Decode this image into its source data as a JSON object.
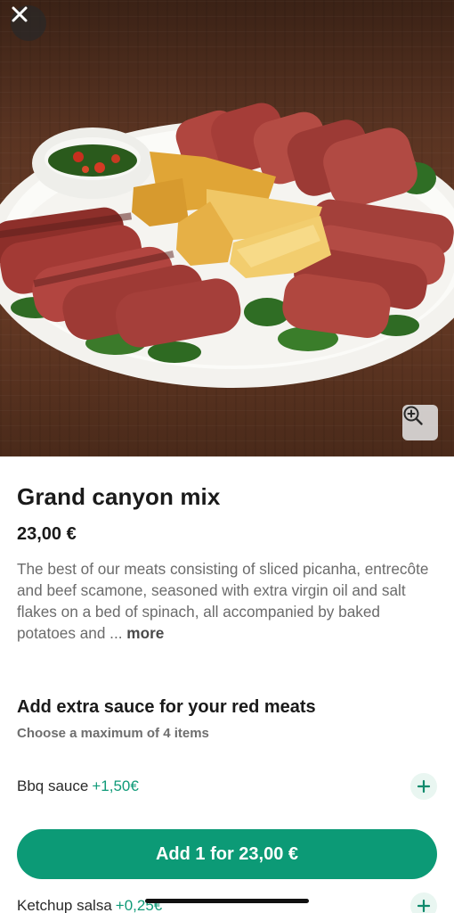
{
  "product": {
    "title": "Grand canyon mix",
    "price": "23,00 €",
    "description": "The best of our meats consisting of sliced picanha, entrecôte and beef scamone, seasoned with extra virgin oil and salt flakes on a bed of spinach, all accompanied by baked potatoes and ...",
    "more_label": "more"
  },
  "extras": {
    "title": "Add extra sauce for your red meats",
    "subtitle": "Choose a maximum of 4 items",
    "options": [
      {
        "label": "Bbq sauce",
        "price": "+1,50€"
      },
      {
        "label": "Ketchup salsa",
        "price": "+0,25€"
      }
    ]
  },
  "cta": {
    "label": "Add 1 for 23,00 €"
  },
  "icons": {
    "close": "close-icon",
    "zoom": "zoom-in-icon",
    "add": "plus-icon"
  },
  "colors": {
    "accent": "#0c9a76",
    "accent_text": "#0f9a78",
    "accent_soft": "#e9f6f1"
  }
}
